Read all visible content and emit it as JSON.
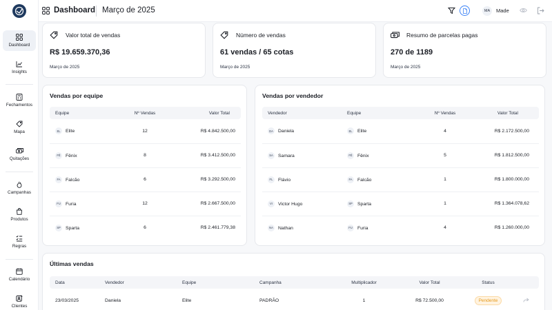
{
  "topbar": {
    "title": "Dashboard",
    "period": "Março de 2025",
    "user_initials": "MA",
    "user_name": "Made"
  },
  "sidebar": {
    "items": [
      {
        "label": "Dashboard"
      },
      {
        "label": "Insights"
      },
      {
        "label": "Fechamentos"
      },
      {
        "label": "Mapa"
      },
      {
        "label": "Quitações"
      },
      {
        "label": "Campanhas"
      },
      {
        "label": "Produtos"
      },
      {
        "label": "Regras"
      },
      {
        "label": "Calendário"
      },
      {
        "label": "Clientes"
      }
    ]
  },
  "kpis": [
    {
      "label": "Valor total de vendas",
      "value": "R$ 19.659.370,36",
      "sub": "Março de 2025",
      "icon": "tag-icon"
    },
    {
      "label": "Número de vendas",
      "value": "61 vendas / 65 cotas",
      "sub": "Março de 2025",
      "icon": "tag-icon"
    },
    {
      "label": "Resumo de parcelas pagas",
      "value": "270 de 1189",
      "sub": "Março de 2025",
      "icon": "money-icon"
    }
  ],
  "team_sales": {
    "title": "Vendas por equipe",
    "headers": [
      "Equipe",
      "Nº Vendas",
      "Valor Total"
    ],
    "rows": [
      {
        "badge": "EL",
        "team": "Elite",
        "count": "12",
        "total": "R$ 4.842.500,00"
      },
      {
        "badge": "FÊ",
        "team": "Fênix",
        "count": "8",
        "total": "R$ 3.412.500,00"
      },
      {
        "badge": "FA",
        "team": "Falcão",
        "count": "6",
        "total": "R$ 3.292.500,00"
      },
      {
        "badge": "FU",
        "team": "Furia",
        "count": "12",
        "total": "R$ 2.667.500,00"
      },
      {
        "badge": "SP",
        "team": "Sparta",
        "count": "6",
        "total": "R$ 2.461.779,38"
      }
    ]
  },
  "seller_sales": {
    "title": "Vendas por vendedor",
    "headers": [
      "Vendedor",
      "Equipe",
      "Nº Vendas",
      "Valor Total"
    ],
    "rows": [
      {
        "sbadge": "DA",
        "seller": "Daniela",
        "tbadge": "EL",
        "team": "Elite",
        "count": "4",
        "total": "R$ 2.172.500,00"
      },
      {
        "sbadge": "SA",
        "seller": "Samara",
        "tbadge": "FÊ",
        "team": "Fênix",
        "count": "5",
        "total": "R$ 1.812.500,00"
      },
      {
        "sbadge": "FL",
        "seller": "Flávio",
        "tbadge": "FA",
        "team": "Falcão",
        "count": "1",
        "total": "R$ 1.800.000,00"
      },
      {
        "sbadge": "VI",
        "seller": "Victor Hugo",
        "tbadge": "SP",
        "team": "Sparta",
        "count": "1",
        "total": "R$ 1.364.078,62"
      },
      {
        "sbadge": "NA",
        "seller": "Nathan",
        "tbadge": "FU",
        "team": "Furia",
        "count": "4",
        "total": "R$ 1.260.000,00"
      }
    ]
  },
  "recent_sales": {
    "title": "Últimas vendas",
    "headers": [
      "Data",
      "Vendedor",
      "Equipe",
      "Campanha",
      "Multiplicador",
      "Valor Total",
      "Status"
    ],
    "rows": [
      {
        "date": "23/03/2025",
        "seller": "Daniela",
        "team": "Elite",
        "campaign": "PADRÃO",
        "multiplier": "1",
        "total": "R$ 72.500,00",
        "status": "Pendente"
      }
    ]
  }
}
